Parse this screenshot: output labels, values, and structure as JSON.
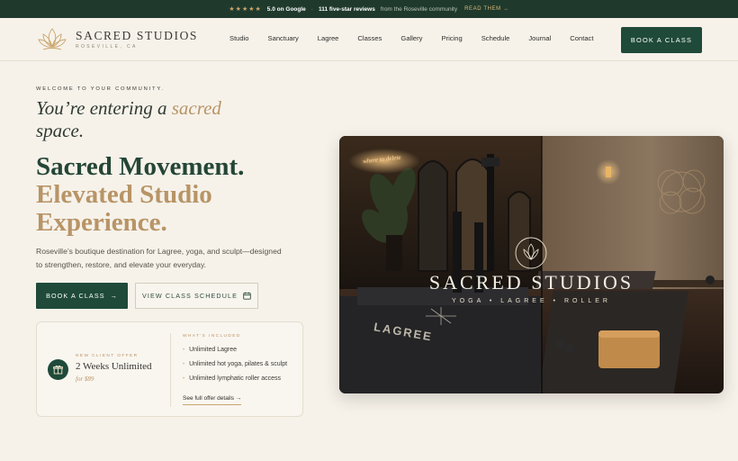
{
  "topbar": {
    "stars": "★★★★★",
    "rating": "5.0 on Google",
    "separator": "·",
    "reviews_count": "111 five-star reviews",
    "reviews_source": "from the Roseville community",
    "read_link": "READ THEM →"
  },
  "header": {
    "logo_name": "SACRED STUDIOS",
    "logo_location": "ROSEVILLE, CA",
    "nav": [
      "Studio",
      "Sanctuary",
      "Lagree",
      "Classes",
      "Gallery",
      "Pricing",
      "Schedule",
      "Journal",
      "Contact"
    ],
    "cta_label": "BOOK A CLASS"
  },
  "hero": {
    "eyebrow": "WELCOME TO YOUR COMMUNITY.",
    "script_part1": "You’re entering a ",
    "script_accent": "sacred",
    "script_part2": " space.",
    "headline_line1": "Sacred Movement.",
    "headline_gold": "Elevated Studio Experience.",
    "lede": "Roseville’s boutique destination for Lagree, yoga, and sculpt—designed to strengthen, restore, and elevate your everyday.",
    "primary_label": "BOOK A CLASS",
    "primary_arrow": "→",
    "secondary_label": "VIEW CLASS SCHEDULE",
    "secondary_icon": "calendar-icon"
  },
  "offer": {
    "kicker": "NEW CLIENT OFFER",
    "title": "2 Weeks Unlimited",
    "price": "for $89",
    "icon": "gift-icon",
    "included_heading": "WHAT'S INCLUDED",
    "included": [
      "Unlimited Lagree",
      "Unlimited hot yoga, pilates & sculpt",
      "Unlimited lymphatic roller access"
    ],
    "link_label": "See full offer details →"
  },
  "photo": {
    "studio_name": "SACRED STUDIOS",
    "tagline": "YOGA  •  LAGREE  •  ROLLER",
    "neon_sign": "where to delete",
    "machine_label": "LAGREE"
  },
  "colors": {
    "brand_green": "#1f4a3a",
    "gold_accent": "#b89466",
    "background": "#f6f2ea"
  }
}
